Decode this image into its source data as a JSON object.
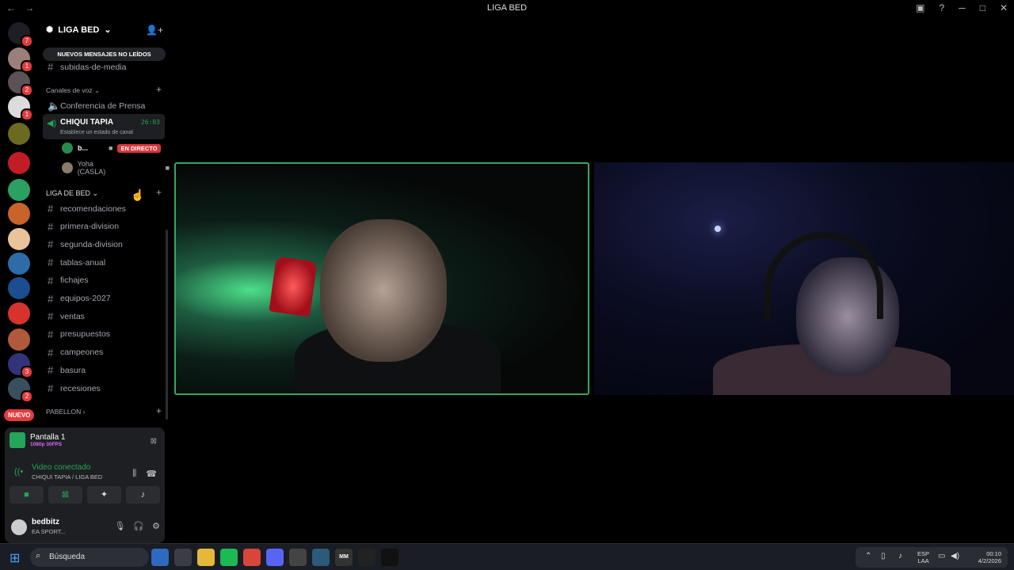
{
  "window": {
    "title": "LIGA BED",
    "nav": [
      "←",
      "→"
    ],
    "controls": [
      "▣",
      "?",
      "─",
      "□",
      "✕"
    ]
  },
  "servers": {
    "new_label": "NUEVO",
    "items": [
      {
        "icon": "discord-home-icon",
        "color": "#1e1f22",
        "badge": "7"
      },
      {
        "icon": "server-avatar-icon",
        "color": "#9b7f7a",
        "badge": "1"
      },
      {
        "icon": "server-avatar-icon",
        "color": "#5a5254",
        "badge": "2"
      },
      {
        "icon": "server-avatar-icon",
        "color": "#dcdcdc",
        "badge": "1"
      },
      {
        "icon": "liga-bed-server-icon",
        "color": "#6b6a20",
        "badge": ""
      },
      {
        "icon": "server-avatar-icon",
        "color": "#c21c25",
        "badge": ""
      },
      {
        "icon": "server-avatar-icon",
        "color": "#2aa063",
        "badge": ""
      },
      {
        "icon": "server-avatar-icon",
        "color": "#c8632a",
        "badge": ""
      },
      {
        "icon": "server-avatar-icon",
        "color": "#e8c49a",
        "badge": ""
      },
      {
        "icon": "server-avatar-icon",
        "color": "#2d6ca8",
        "badge": ""
      },
      {
        "icon": "server-avatar-icon",
        "color": "#1b4d8f",
        "badge": ""
      },
      {
        "icon": "server-avatar-icon",
        "color": "#d8322f",
        "badge": ""
      },
      {
        "icon": "server-avatar-icon",
        "color": "#b05a3b",
        "badge": ""
      },
      {
        "icon": "server-avatar-icon",
        "color": "#33337a",
        "badge": "3"
      },
      {
        "icon": "server-avatar-icon",
        "color": "#3a4f5e",
        "badge": "2"
      }
    ]
  },
  "sidebar": {
    "guild_name": "LIGA BED",
    "unread_pill": "NUEVOS MENSAJES NO LEÍDOS",
    "channels_top": [
      {
        "name": "subidas-de-media"
      }
    ],
    "voice_category": "Canales de voz",
    "voice_channels": [
      {
        "name": "Conferencia de Prensa"
      }
    ],
    "active_voice": {
      "name": "CHIQUI TAPIA",
      "time": "26:03",
      "status": "Establece un estado de canal"
    },
    "voice_users": [
      {
        "name": "b...",
        "live": "EN DIRECTO",
        "avatar_color": "#2a8a4a"
      },
      {
        "name": "Yoha (CASLA)",
        "live": "",
        "avatar_color": "#8a7a6a"
      }
    ],
    "text_category": "LIGA DE BED",
    "text_channels": [
      {
        "name": "recomendaciones"
      },
      {
        "name": "primera-division"
      },
      {
        "name": "segunda-division"
      },
      {
        "name": "tablas-anual"
      },
      {
        "name": "fichajes"
      },
      {
        "name": "equipos-2027"
      },
      {
        "name": "ventas"
      },
      {
        "name": "presupuestos"
      },
      {
        "name": "campeones"
      },
      {
        "name": "basura"
      },
      {
        "name": "recesiones"
      }
    ],
    "bottom_category": "PABELLON"
  },
  "panel": {
    "share_title": "Pantalla 1",
    "share_quality": "1080p 30FPS",
    "voice_status": "Video conectado",
    "voice_location": "CHIQUI TAPIA / LIGA BED",
    "user_name": "bedbitz",
    "user_status": "EA SPORT..."
  },
  "taskbar": {
    "search_placeholder": "Búsqueda",
    "apps": [
      {
        "icon": "search-widget-icon",
        "color": "#2e6bc0",
        "label": ""
      },
      {
        "icon": "store-icon",
        "color": "#3a3d44",
        "label": ""
      },
      {
        "icon": "file-explorer-icon",
        "color": "#e5b73b",
        "label": ""
      },
      {
        "icon": "spotify-icon",
        "color": "#1db954",
        "label": ""
      },
      {
        "icon": "chrome-icon",
        "color": "#d8453a",
        "label": ""
      },
      {
        "icon": "discord-icon",
        "color": "#5865f2",
        "label": ""
      },
      {
        "icon": "obs-icon",
        "color": "#444",
        "label": ""
      },
      {
        "icon": "app-icon",
        "color": "#2b5a7a",
        "label": ""
      },
      {
        "icon": "app-icon",
        "color": "#333",
        "label": "MM"
      },
      {
        "icon": "capcut-icon",
        "color": "#222",
        "label": ""
      },
      {
        "icon": "app-icon",
        "color": "#111",
        "label": ""
      }
    ],
    "lang_line1": "ESP",
    "lang_line2": "LAA",
    "time": "00:10",
    "date": "4/2/2026"
  }
}
